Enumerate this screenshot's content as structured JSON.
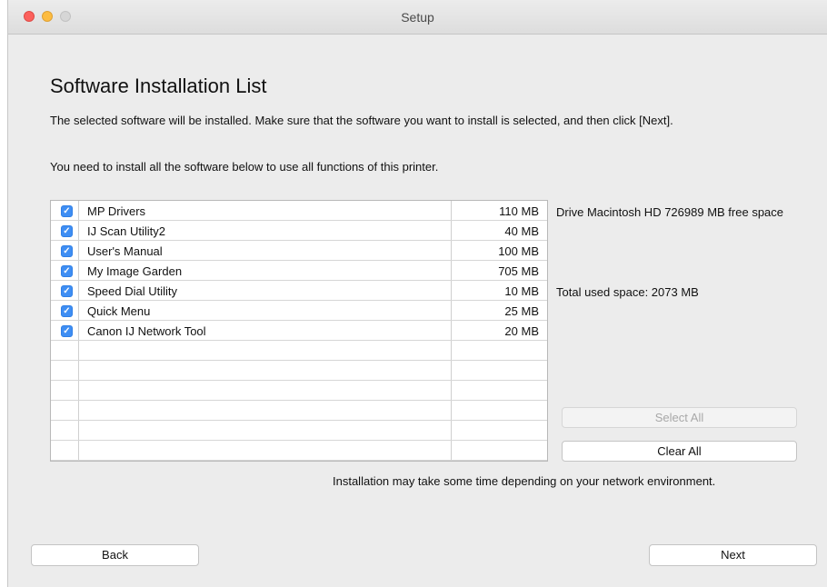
{
  "window": {
    "title": "Setup"
  },
  "page": {
    "heading": "Software Installation List",
    "description": "The selected software will be installed. Make sure that the software you want to install is selected, and then click [Next].",
    "instruction": "You need to install all the software below to use all functions of this printer."
  },
  "software_list": [
    {
      "name": "MP Drivers",
      "size": "110 MB",
      "checked": true
    },
    {
      "name": "IJ Scan Utility2",
      "size": "40 MB",
      "checked": true
    },
    {
      "name": "User's Manual",
      "size": "100 MB",
      "checked": true
    },
    {
      "name": "My Image Garden",
      "size": "705 MB",
      "checked": true
    },
    {
      "name": "Speed Dial Utility",
      "size": "10 MB",
      "checked": true
    },
    {
      "name": "Quick Menu",
      "size": "25 MB",
      "checked": true
    },
    {
      "name": "Canon IJ Network Tool",
      "size": "20 MB",
      "checked": true
    }
  ],
  "side_info": {
    "drive": "Drive Macintosh HD 726989 MB free space",
    "total_used": "Total used space: 2073 MB"
  },
  "buttons": {
    "select_all": "Select All",
    "clear_all": "Clear All",
    "back": "Back",
    "next": "Next"
  },
  "footer_note": "Installation may take some time depending on your network environment.",
  "colors": {
    "checkbox_accent": "#3f8ef3",
    "close": "#fc605c",
    "minimize": "#fdbc40",
    "zoom_inactive": "#d6d6d6"
  },
  "icons": {
    "check": "checkmark-icon"
  }
}
